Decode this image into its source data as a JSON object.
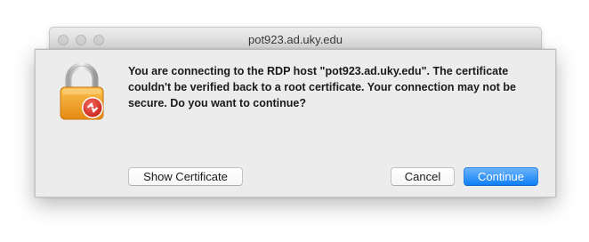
{
  "window": {
    "title": "pot923.ad.uky.edu"
  },
  "dialog": {
    "message": "You are connecting to the RDP host \"pot923.ad.uky.edu\". The certificate couldn't be verified back to a root certificate. Your connection may not be secure. Do you want to continue?",
    "icon": "lock-with-remote-desktop-badge-icon"
  },
  "buttons": {
    "show_certificate": "Show Certificate",
    "cancel": "Cancel",
    "continue": "Continue"
  },
  "colors": {
    "accent": "#1a86f7",
    "lock_body": "#f5a623",
    "badge": "#e0382c"
  }
}
